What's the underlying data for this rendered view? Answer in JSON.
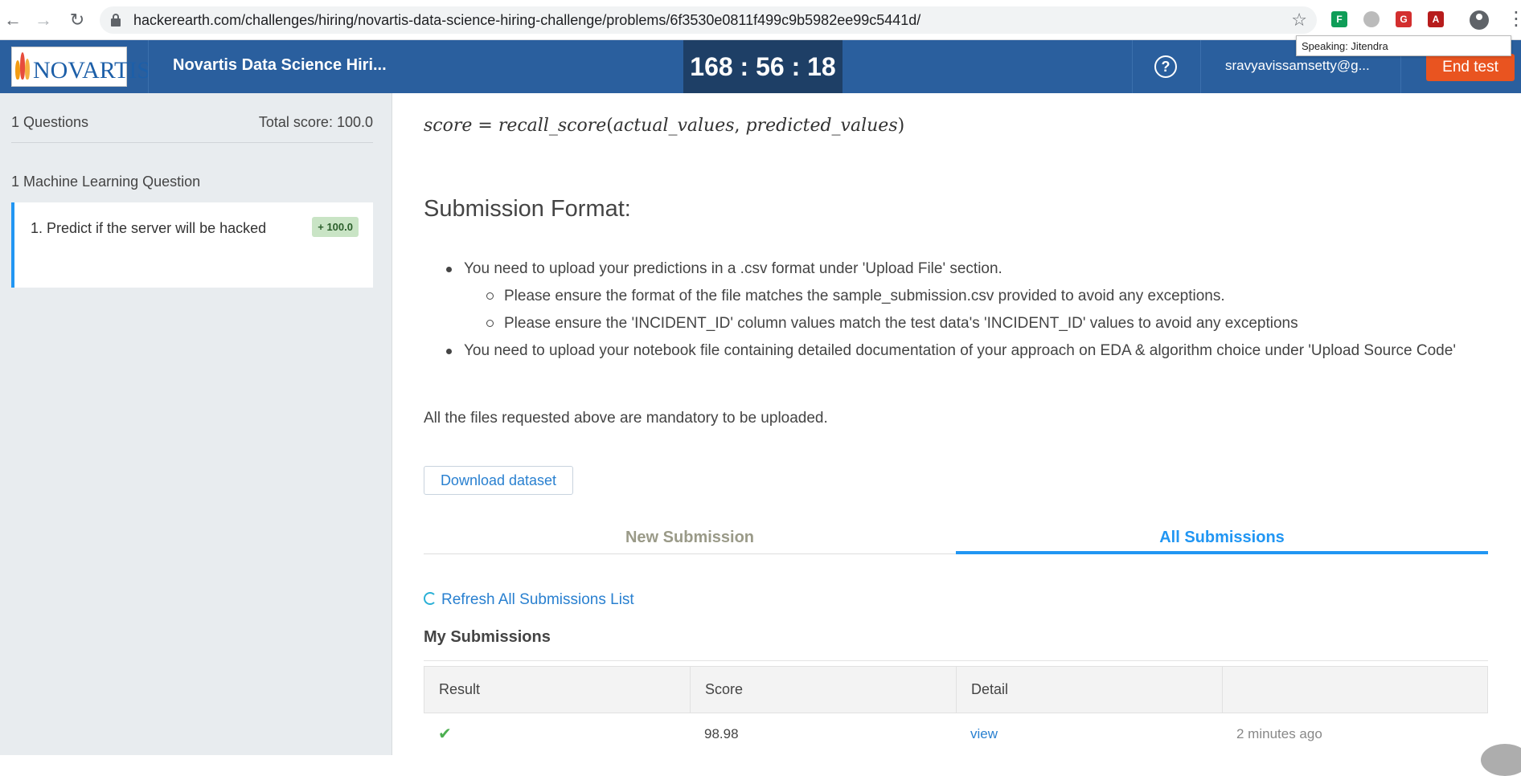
{
  "browser": {
    "url": "hackerearth.com/challenges/hiring/novartis-data-science-hiring-challenge/problems/6f3530e0811f499c9b5982ee99c5441d/",
    "tooltip": "Speaking: Jitendra"
  },
  "header": {
    "logo_text": "NOVARTIS",
    "challenge_title": "Novartis Data Science Hiri...",
    "timer": "168 : 56 : 18",
    "user_email": "sravyavissamsetty@g...",
    "end_test_label": "End test"
  },
  "sidebar": {
    "questions_count": "1 Questions",
    "total_score": "Total score: 100.0",
    "section_label": "1 Machine Learning Question",
    "question_title": "1. Predict if the server will be hacked",
    "question_score": "+ 100.0"
  },
  "main": {
    "formula": {
      "lhs": "score",
      "op": " = ",
      "func": "recall_score",
      "lparen": "(",
      "arg1": "actual_values",
      "comma": ", ",
      "arg2": "predicted_values",
      "rparen": ")"
    },
    "submission_heading": "Submission Format:",
    "bullets": [
      "You need to upload your predictions in a .csv format under 'Upload File' section.",
      "You need to upload your notebook file containing detailed documentation of your approach on EDA & algorithm choice under 'Upload Source Code'"
    ],
    "sub_bullets": [
      "Please ensure the format of the file matches the sample_submission.csv provided to avoid any exceptions.",
      "Please ensure the 'INCIDENT_ID' column values match the test data's 'INCIDENT_ID' values to avoid any exceptions"
    ],
    "mandatory_note": "All the files requested above are mandatory to be uploaded.",
    "download_label": "Download dataset",
    "tabs": [
      "New Submission",
      "All Submissions"
    ],
    "refresh_label": "Refresh All Submissions List",
    "my_submissions_label": "My Submissions",
    "table": {
      "headers": [
        "Result",
        "Score",
        "Detail",
        ""
      ],
      "rows": [
        {
          "result": "✔",
          "score": "98.98",
          "detail": "view",
          "time": "2 minutes ago"
        }
      ]
    }
  },
  "colors": {
    "header_bg": "#2a5f9e",
    "timer_bg": "#1e3f66",
    "end_test": "#e95420",
    "accent": "#2196f3",
    "success": "#4caf50"
  }
}
